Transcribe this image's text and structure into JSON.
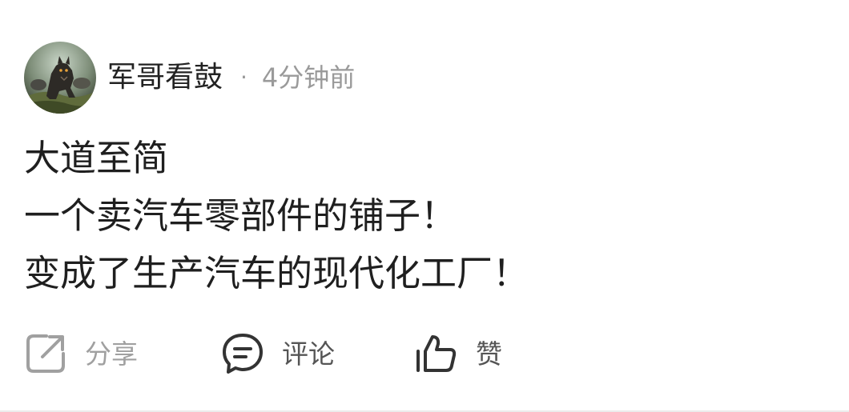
{
  "post": {
    "author": "军哥看鼓",
    "separator": "·",
    "timestamp": "4分钟前",
    "content_lines": [
      "大道至简",
      "一个卖汽车零部件的铺子！",
      "变成了生产汽车的现代化工厂！"
    ]
  },
  "actions": {
    "share": {
      "label": "分享",
      "icon": "share-icon"
    },
    "comment": {
      "label": "评论",
      "icon": "comment-icon"
    },
    "like": {
      "label": "赞",
      "icon": "thumbs-up-icon"
    }
  },
  "colors": {
    "text_primary": "#1f1f1f",
    "text_secondary": "#9a9a9a",
    "icon_muted": "#a0a0a0",
    "icon_dark": "#333333"
  }
}
